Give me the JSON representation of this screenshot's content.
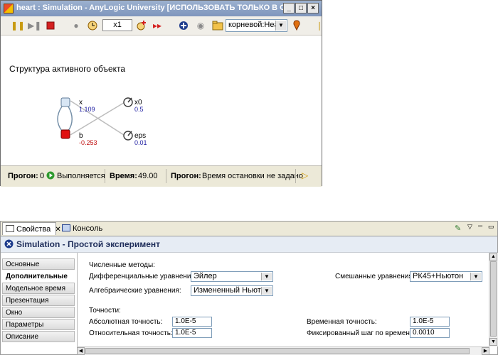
{
  "window": {
    "title": "heart : Simulation - AnyLogic University  [ИСПОЛЬЗОВАТЬ ТОЛЬКО В ОБРАЗО...",
    "min_glyph": "_",
    "max_glyph": "□",
    "close_glyph": "×"
  },
  "toolbar": {
    "speed": "x1",
    "root_combo": "корневой:Heart"
  },
  "canvas": {
    "heading": "Структура активного объекта",
    "nodes": [
      {
        "name": "x",
        "value": "1.109"
      },
      {
        "name": "b",
        "value": "-0.253"
      },
      {
        "name": "x0",
        "value": "0.5"
      },
      {
        "name": "eps",
        "value": "0.01"
      }
    ]
  },
  "status": {
    "run_label": "Прогон:",
    "run_value": "0",
    "running_text": "Выполняется",
    "time_label": "Время:",
    "time_value": "49.00",
    "run2_label": "Прогон:",
    "stop_text": "Время остановки не задано"
  },
  "panel": {
    "tabs": [
      {
        "label": "Свойства"
      },
      {
        "label": "Консоль"
      }
    ],
    "header_title": "Simulation - Простой эксперимент",
    "sidebar": [
      {
        "label": "Основные"
      },
      {
        "label": "Дополнительные"
      },
      {
        "label": "Модельное время"
      },
      {
        "label": "Презентация"
      },
      {
        "label": "Окно"
      },
      {
        "label": "Параметры"
      },
      {
        "label": "Описание"
      }
    ],
    "methods": {
      "section": "Численные методы:",
      "diff_label": "Дифференциальные уравнения:",
      "diff_value": "Эйлер",
      "alg_label": "Алгебраические уравнения:",
      "alg_value": "Измененный Ньютон",
      "mixed_label": "Смешанные уравнения:",
      "mixed_value": "РК45+Ньютон"
    },
    "accuracy": {
      "section": "Точности:",
      "abs_label": "Абсолютная точность:",
      "abs_value": "1.0E-5",
      "rel_label": "Относительная точность:",
      "rel_value": "1.0E-5",
      "time_label": "Временная точность:",
      "time_value": "1.0E-5",
      "step_label": "Фиксированный шаг по времени:",
      "step_value": "0.0010"
    }
  },
  "colors": {
    "stock_x": "#d8e6f4",
    "stock_b": "#e01010",
    "value_blue": "#1a1aa0",
    "value_red": "#c01010"
  }
}
